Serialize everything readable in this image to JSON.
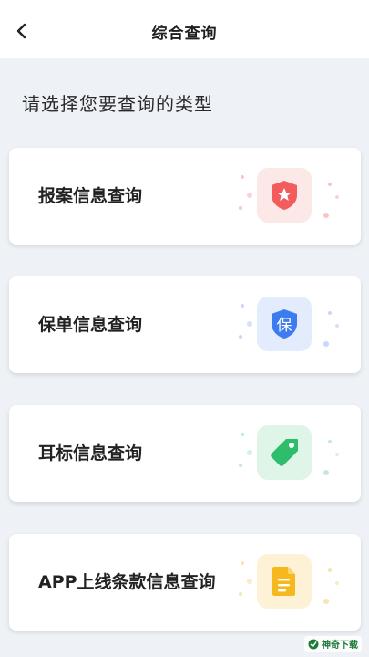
{
  "header": {
    "title": "综合查询",
    "back_icon": "chevron-left-icon"
  },
  "prompt": "请选择您要查询的类型",
  "cards": [
    {
      "label": "报案信息查询",
      "icon": "shield-star-icon",
      "accent": "#f25c5c",
      "bg": "#fde8e8"
    },
    {
      "label": "保单信息查询",
      "icon": "shield-bao-icon",
      "accent": "#3d7cf0",
      "bg": "#e3ecfd",
      "icon_text": "保"
    },
    {
      "label": "耳标信息查询",
      "icon": "tag-icon",
      "accent": "#2ebd6b",
      "bg": "#dff5e7"
    },
    {
      "label": "APP上线条款信息查询",
      "icon": "document-icon",
      "accent": "#f5b81e",
      "bg": "#fdf2d6"
    }
  ],
  "watermark": {
    "text": "神奇下载",
    "icon": "watermark-logo-icon"
  }
}
